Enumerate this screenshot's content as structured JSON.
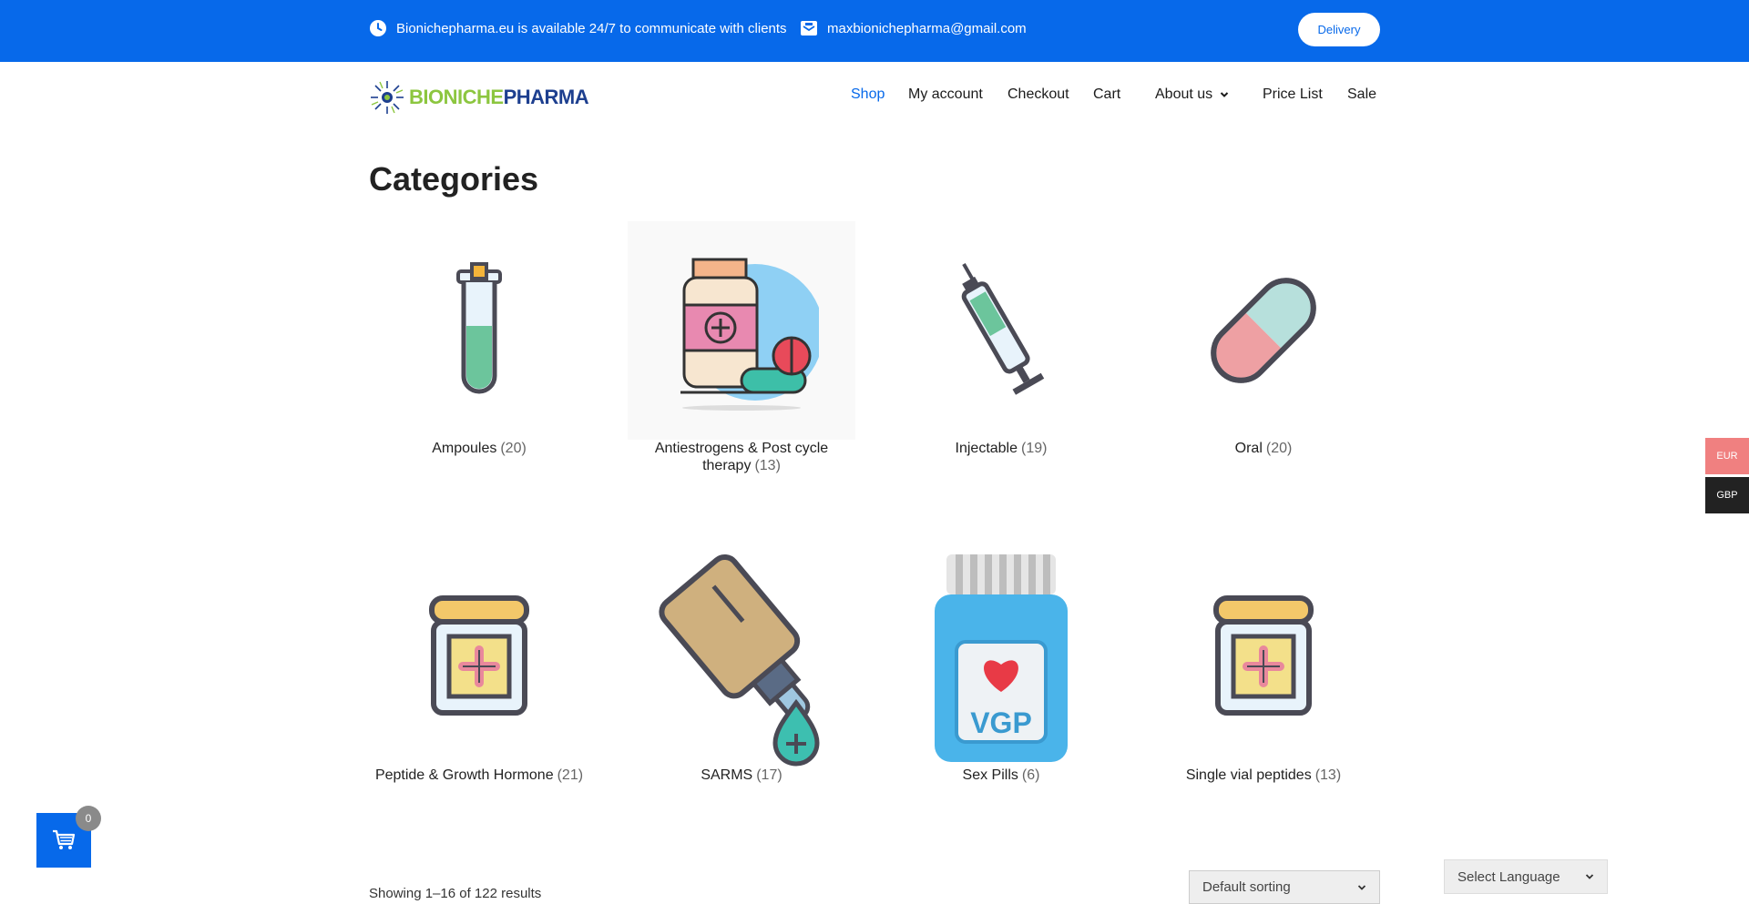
{
  "topbar": {
    "availability": "Bionichepharma.eu is available 24/7 to communicate with clients",
    "email": "maxbionichepharma@gmail.com",
    "delivery_label": "Delivery"
  },
  "logo": {
    "part1": "BIONICHE",
    "part2": "PHARMA"
  },
  "nav": [
    {
      "label": "Shop",
      "active": true
    },
    {
      "label": "My account"
    },
    {
      "label": "Checkout"
    },
    {
      "label": "Cart"
    },
    {
      "label": "About us"
    },
    {
      "label": "Price List"
    },
    {
      "label": "Sale"
    }
  ],
  "page_title": "Categories",
  "categories": [
    {
      "name": "Ampoules",
      "count": "(20)",
      "icon": "test-tube-icon"
    },
    {
      "name": "Antiestrogens & Post cycle therapy",
      "count": "(13)",
      "icon": "medicine-bottle-pills-icon"
    },
    {
      "name": "Injectable",
      "count": "(19)",
      "icon": "syringe-icon"
    },
    {
      "name": "Oral",
      "count": "(20)",
      "icon": "capsule-icon"
    },
    {
      "name": "Peptide & Growth Hormone",
      "count": "(21)",
      "icon": "medicine-jar-icon"
    },
    {
      "name": "SARMS",
      "count": "(17)",
      "icon": "dropper-bottle-icon"
    },
    {
      "name": "Sex Pills",
      "count": "(6)",
      "icon": "pill-bottle-vgp-icon"
    },
    {
      "name": "Single vial peptides",
      "count": "(13)",
      "icon": "medicine-jar-icon"
    }
  ],
  "vgp_label": "VGP",
  "currency": {
    "eur": "EUR",
    "gbp": "GBP"
  },
  "cart": {
    "count": "0"
  },
  "results_text": "Showing 1–16 of 122 results",
  "sorting": {
    "selected": "Default sorting"
  },
  "language": {
    "selected": "Select Language"
  },
  "colors": {
    "brand_blue": "#0769ea",
    "eur_bg": "#f08080",
    "gbp_bg": "#222222"
  }
}
